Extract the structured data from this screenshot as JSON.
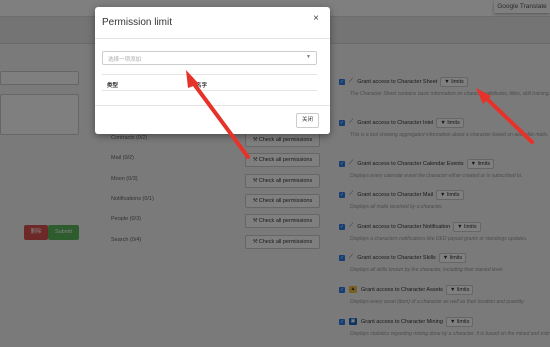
{
  "google_translate": "Google Translate",
  "modal": {
    "title": "Permission limit",
    "close": "×",
    "select_placeholder": "选择一项添加",
    "columns": [
      "类型",
      "名字"
    ],
    "close_button": "关闭"
  },
  "left_panel": {
    "delete_label": "删除",
    "submit_label": "Submit"
  },
  "categories": [
    {
      "label": "Mail (0/2)",
      "button": "Check all permissions"
    },
    {
      "label": "Moon (0/3)",
      "button": "Check all permissions"
    },
    {
      "label": "Notifications (0/1)",
      "button": "Check all permissions"
    },
    {
      "label": "People (0/3)",
      "button": "Check all permissions"
    },
    {
      "label": "Search (0/4)",
      "button": "Check all permissions"
    }
  ],
  "partial_category": {
    "label": "Contracts (0/2)",
    "button": "Check all permissions"
  },
  "permissions": [
    {
      "icon": "feather-icon",
      "glyph": "⟋",
      "label": "Grant access to Character Sheet",
      "limits": "limits",
      "desc": "The Character Sheet contains basic information on character attributes, titles, skill training."
    },
    {
      "icon": "feather-icon",
      "glyph": "⟋",
      "label": "Grant access to Character Intel",
      "limits": "limits",
      "desc": "This is a tool showing aggregated information about a character based on available mails."
    },
    {
      "icon": "feather-icon",
      "glyph": "⟋",
      "label": "Grant access to Character Calendar Events",
      "limits": "limits",
      "desc": "Displays every calendar event the character either created or is subscribed to."
    },
    {
      "icon": "feather-icon",
      "glyph": "⟋",
      "label": "Grant access to Character Mail",
      "limits": "limits",
      "desc": "Displays all mails received by a character."
    },
    {
      "icon": "feather-icon",
      "glyph": "⟋",
      "label": "Grant access to Character Notification",
      "limits": "limits",
      "desc": "Displays a characters notifications like DED payout grants or standings updates."
    },
    {
      "icon": "feather-icon",
      "glyph": "⟋",
      "label": "Grant access to Character Skills",
      "limits": "limits",
      "desc": "Displays all skills known by the character, including their trained level."
    },
    {
      "icon": "assets-icon",
      "glyph": "▲",
      "label": "Grant access to Character Assets",
      "limits": "limits",
      "desc": "Displays every asset (item) of a character as well as their location and quantity."
    },
    {
      "icon": "mining-icon",
      "glyph": "▣",
      "label": "Grant access to Character Mining",
      "limits": "limits",
      "desc": "Displays statistics regarding mining done by a character. It is based on the mined and estimated value."
    }
  ]
}
